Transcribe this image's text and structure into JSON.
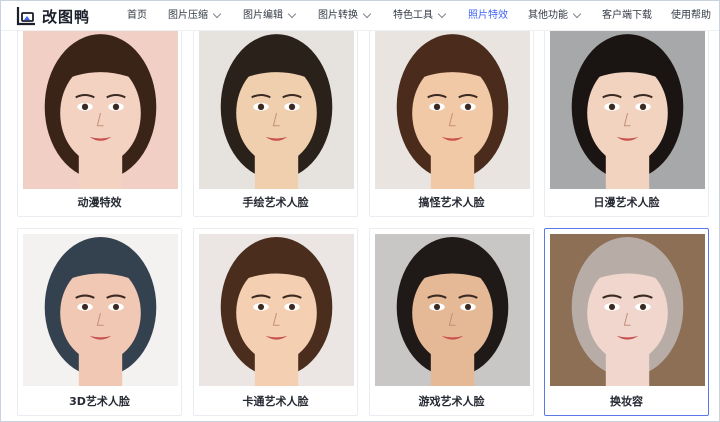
{
  "header": {
    "logo_text": "改图鸭",
    "nav": [
      {
        "label": "首页",
        "has_dropdown": false,
        "active": false
      },
      {
        "label": "图片压缩",
        "has_dropdown": true,
        "active": false
      },
      {
        "label": "图片编辑",
        "has_dropdown": true,
        "active": false
      },
      {
        "label": "图片转换",
        "has_dropdown": true,
        "active": false
      },
      {
        "label": "特色工具",
        "has_dropdown": true,
        "active": false
      },
      {
        "label": "照片特效",
        "has_dropdown": false,
        "active": true
      },
      {
        "label": "其他功能",
        "has_dropdown": true,
        "active": false
      },
      {
        "label": "客户端下载",
        "has_dropdown": false,
        "active": false
      },
      {
        "label": "使用帮助",
        "has_dropdown": false,
        "active": false
      }
    ]
  },
  "effects": [
    {
      "label": "动漫特效",
      "skin": "#f3d2c2",
      "hair": "#3a2418",
      "bg": "#f1cfc4",
      "icon": "anime-portrait-image"
    },
    {
      "label": "手绘艺术人脸",
      "skin": "#f0cfae",
      "hair": "#2b211b",
      "bg": "#e6e3df",
      "icon": "hand-drawn-portrait-image"
    },
    {
      "label": "搞怪艺术人脸",
      "skin": "#f2c9a7",
      "hair": "#4a2b1c",
      "bg": "#e9e4e0",
      "icon": "caricature-portrait-image"
    },
    {
      "label": "日漫艺术人脸",
      "skin": "#f2d3bf",
      "hair": "#1a1412",
      "bg": "#a7a8aa",
      "icon": "japanese-anime-portrait-image"
    },
    {
      "label": "3D艺术人脸",
      "skin": "#f1c8b3",
      "hair": "#34414f",
      "bg": "#f4f2f0",
      "icon": "3d-portrait-image"
    },
    {
      "label": "卡通艺术人脸",
      "skin": "#f4cfb1",
      "hair": "#4a2d1d",
      "bg": "#ebe6e3",
      "icon": "cartoon-portrait-image"
    },
    {
      "label": "游戏艺术人脸",
      "skin": "#e6b996",
      "hair": "#1f1a18",
      "bg": "#c9c7c6",
      "icon": "game-portrait-image"
    },
    {
      "label": "换妆容",
      "skin": "#f0d6cd",
      "hair": "#b7aca6",
      "bg": "#8c6f55",
      "icon": "makeup-portrait-image"
    }
  ],
  "selected_index": 7,
  "colors": {
    "accent": "#3f63f3",
    "selected_border": "#5c78e8"
  }
}
